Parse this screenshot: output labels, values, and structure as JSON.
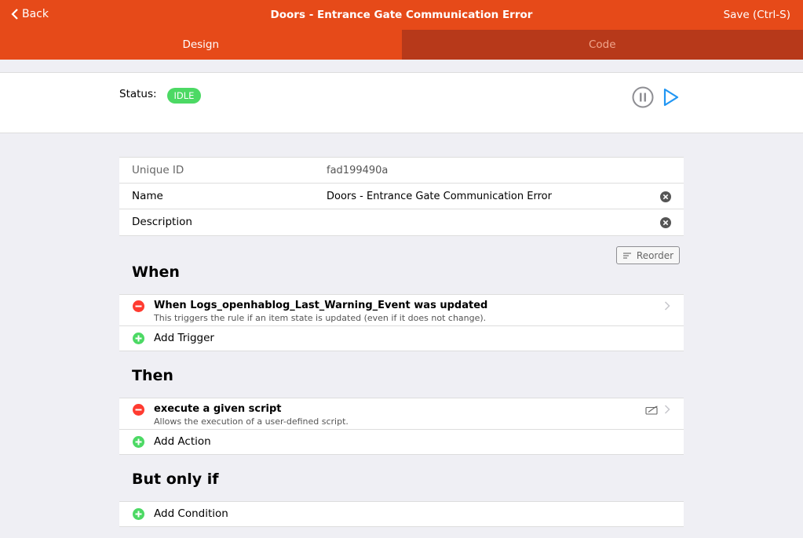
{
  "navbar": {
    "back_label": "Back",
    "title": "Doors - Entrance Gate Communication Error",
    "save_label": "Save (Ctrl-S)",
    "color": "#e64a19"
  },
  "tabs": [
    {
      "label": "Design",
      "active": true
    },
    {
      "label": "Code",
      "active": false
    }
  ],
  "status": {
    "label": "Status:",
    "badge": "IDLE",
    "badge_color": "#4cd964"
  },
  "fields": [
    {
      "label": "Unique ID",
      "value": "fad199490a"
    },
    {
      "label": "Name",
      "value": "Doors - Entrance Gate Communication Error"
    },
    {
      "label": "Description",
      "value": ""
    }
  ],
  "reorder_label": "Reorder",
  "sections": {
    "when": {
      "title": "When",
      "items": [
        {
          "title": "When Logs_openhablog_Last_Warning_Event was updated",
          "subtitle": "This triggers the rule if an item state is updated (even if it does not change)."
        }
      ],
      "add_label": "Add Trigger"
    },
    "then": {
      "title": "Then",
      "items": [
        {
          "title": "execute a given script",
          "subtitle": "Allows the execution of a user-defined script."
        }
      ],
      "add_label": "Add Action"
    },
    "but_only_if": {
      "title": "But only if",
      "add_label": "Add Condition"
    }
  },
  "icons": {
    "back": "chevron-left-icon",
    "pause": "pause-circle-icon",
    "play": "play-icon",
    "clear": "clear-circle-icon",
    "reorder": "reorder-icon",
    "remove": "remove-circle-icon",
    "add": "add-circle-icon",
    "chevron": "chevron-right-icon",
    "script": "script-edit-icon"
  },
  "colors": {
    "remove": "#ff3b30",
    "add": "#4cd964",
    "play": "#2196f3"
  }
}
